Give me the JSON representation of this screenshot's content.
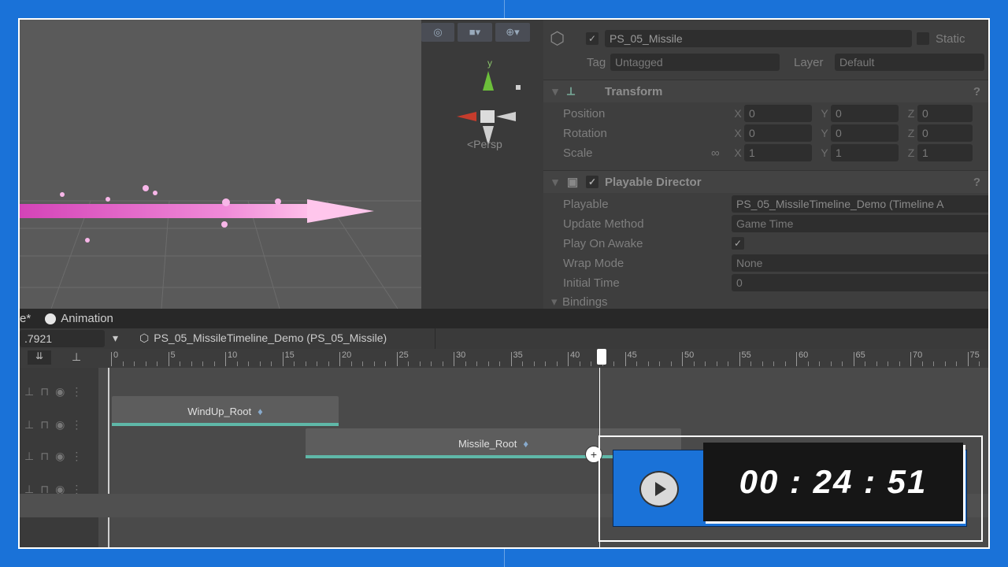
{
  "inspector": {
    "object_name": "PS_05_Missile",
    "static_label": "Static",
    "tag_label": "Tag",
    "tag_value": "Untagged",
    "layer_label": "Layer",
    "layer_value": "Default",
    "transform": {
      "title": "Transform",
      "rows": [
        {
          "label": "Position",
          "x": "0",
          "y": "0",
          "z": "0"
        },
        {
          "label": "Rotation",
          "x": "0",
          "y": "0",
          "z": "0"
        },
        {
          "label": "Scale",
          "x": "1",
          "y": "1",
          "z": "1"
        }
      ]
    },
    "director": {
      "title": "Playable Director",
      "playable_label": "Playable",
      "playable_value": "PS_05_MissileTimeline_Demo (Timeline A",
      "update_label": "Update Method",
      "update_value": "Game Time",
      "awake_label": "Play On Awake",
      "wrap_label": "Wrap Mode",
      "wrap_value": "None",
      "initial_label": "Initial Time",
      "initial_value": "0",
      "bindings_label": "Bindings"
    }
  },
  "scene": {
    "persp_label": "<Persp",
    "y_axis": "y"
  },
  "timeline": {
    "tab_left": "e*",
    "tab_animation": "Animation",
    "time_field": ".7921",
    "asset_path": "PS_05_MissileTimeline_Demo (PS_05_Missile)",
    "ruler_ticks": [
      "0",
      "5",
      "10",
      "15",
      "20",
      "25",
      "30",
      "35",
      "40",
      "45",
      "50",
      "55",
      "60",
      "65",
      "70",
      "75"
    ],
    "clips": [
      {
        "name": "WindUp_Root"
      },
      {
        "name": "Missile_Root"
      }
    ]
  },
  "overlay": {
    "timer": "00 : 24 : 51"
  },
  "colors": {
    "frame": "#1a72d8",
    "clip_bar": "#5fb8a8",
    "arrow": "#e86fd0"
  }
}
